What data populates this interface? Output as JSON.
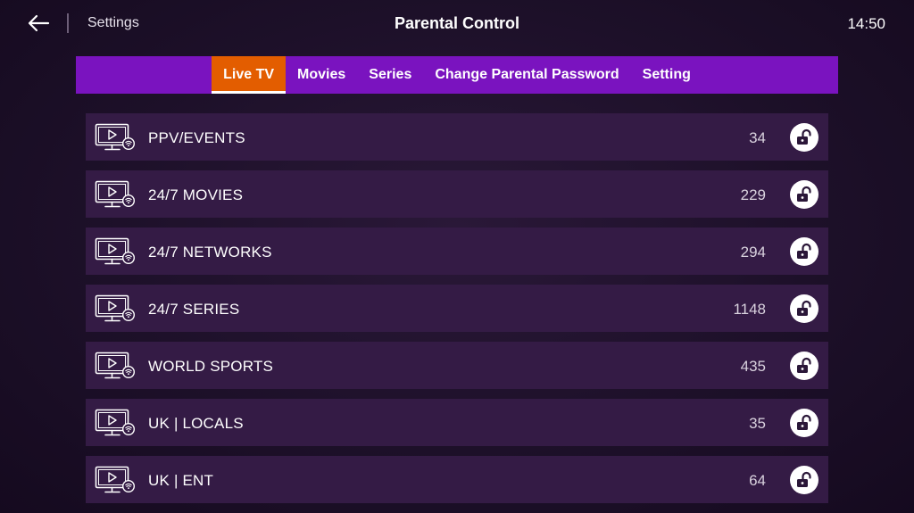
{
  "header": {
    "breadcrumb": "Settings",
    "title": "Parental Control",
    "time": "14:50",
    "back_icon": "arrow-left-icon"
  },
  "tabs": [
    {
      "label": "Live TV",
      "active": true
    },
    {
      "label": "Movies",
      "active": false
    },
    {
      "label": "Series",
      "active": false
    },
    {
      "label": "Change Parental Password",
      "active": false
    },
    {
      "label": "Setting",
      "active": false
    }
  ],
  "categories": [
    {
      "name": "PPV/EVENTS",
      "count": "34",
      "locked": false
    },
    {
      "name": "24/7 MOVIES",
      "count": "229",
      "locked": false
    },
    {
      "name": "24/7 NETWORKS",
      "count": "294",
      "locked": false
    },
    {
      "name": "24/7 SERIES",
      "count": "1148",
      "locked": false
    },
    {
      "name": "WORLD SPORTS",
      "count": "435",
      "locked": false
    },
    {
      "name": "UK | LOCALS",
      "count": "35",
      "locked": false
    },
    {
      "name": "UK | ENT",
      "count": "64",
      "locked": false
    }
  ],
  "colors": {
    "tab_bar": "#7a13bf",
    "tab_active": "#e35d00",
    "row_background": "#341b45",
    "background": "#1d1029"
  }
}
